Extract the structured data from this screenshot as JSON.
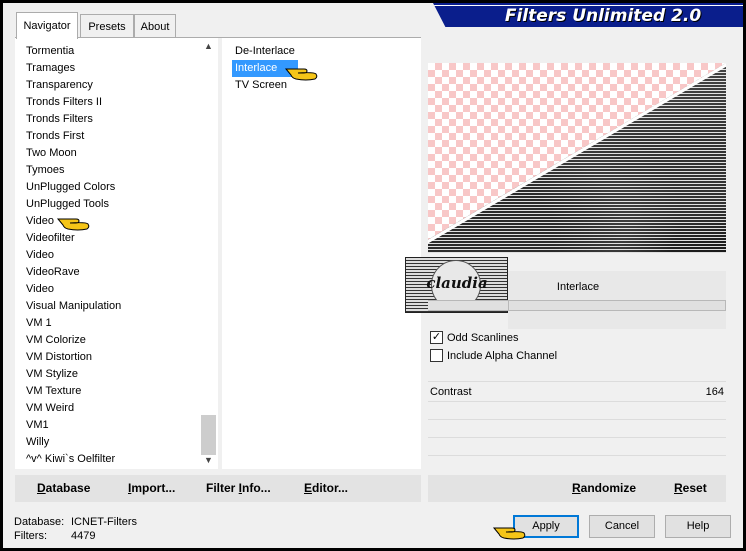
{
  "title": "Filters Unlimited 2.0",
  "tabs": [
    {
      "label": "Navigator"
    },
    {
      "label": "Presets"
    },
    {
      "label": "About"
    }
  ],
  "categories": [
    "Tormentia",
    "Tramages",
    "Transparency",
    "Tronds Filters II",
    "Tronds Filters",
    "Tronds First",
    "Two Moon",
    "Tymoes",
    "UnPlugged Colors",
    "UnPlugged Tools",
    "Video",
    "Videofilter",
    "Video",
    "VideoRave",
    "Video",
    "Visual Manipulation",
    "VM 1",
    "VM Colorize",
    "VM Distortion",
    "VM Stylize",
    "VM Texture",
    "VM Weird",
    "VM1",
    "Willy",
    "^v^ Kiwi`s Oelfilter"
  ],
  "filters": [
    "De-Interlace",
    "Interlace",
    "TV Screen"
  ],
  "selected_filter": "Interlace",
  "watermark": "claudia",
  "params": {
    "title": "Interlace",
    "odd_scanlines": {
      "label": "Odd Scanlines",
      "checked": true,
      "mark": "✓"
    },
    "alpha_channel": {
      "label": "Include Alpha Channel",
      "checked": false,
      "mark": ""
    },
    "contrast": {
      "label": "Contrast",
      "value": "164"
    }
  },
  "left_buttons": {
    "database": {
      "u": "D",
      "rest": "atabase"
    },
    "import": {
      "u": "I",
      "rest": "mport..."
    },
    "filter_info": {
      "pre": "Filter ",
      "u": "I",
      "rest": "nfo..."
    },
    "editor": {
      "u": "E",
      "rest": "ditor..."
    }
  },
  "right_buttons": {
    "randomize": {
      "u": "R",
      "rest": "andomize"
    },
    "reset": {
      "u": "R",
      "rest": "eset"
    }
  },
  "status": {
    "database_label": "Database:",
    "database_value": "ICNET-Filters",
    "filters_label": "Filters:",
    "filters_value": "4479"
  },
  "dialog_buttons": {
    "apply": "Apply",
    "cancel": "Cancel",
    "help": "Help"
  },
  "colors": {
    "banner": "#0a1e8c",
    "selection": "#3399ff",
    "checker": "#f8c7c7",
    "hand": "#f5c518"
  },
  "icons": {
    "pointer": "pointing-hand-icon",
    "scroll_up": "up-arrow-icon",
    "scroll_down": "down-arrow-icon"
  }
}
